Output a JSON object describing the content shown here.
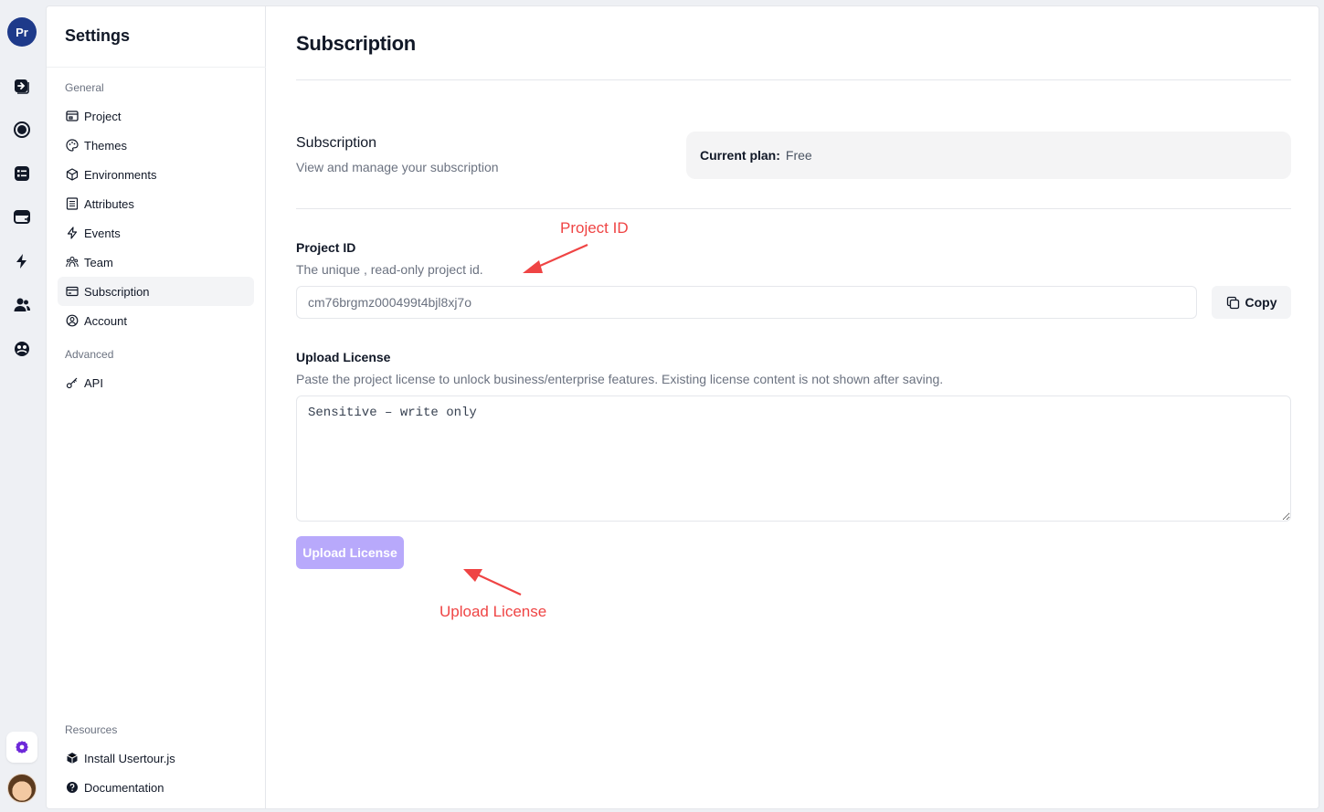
{
  "rail": {
    "project_badge": "Pr",
    "icons": [
      "flows-icon",
      "checklists-icon",
      "launchers-icon",
      "banners-icon",
      "events-icon",
      "users-icon",
      "companies-icon"
    ]
  },
  "sidebar": {
    "title": "Settings",
    "groups": [
      {
        "label": "General",
        "items": [
          {
            "label": "Project",
            "icon": "project-icon"
          },
          {
            "label": "Themes",
            "icon": "palette-icon"
          },
          {
            "label": "Environments",
            "icon": "cube-icon"
          },
          {
            "label": "Attributes",
            "icon": "list-icon"
          },
          {
            "label": "Events",
            "icon": "bolt-icon"
          },
          {
            "label": "Team",
            "icon": "team-icon"
          },
          {
            "label": "Subscription",
            "icon": "card-icon",
            "active": true
          },
          {
            "label": "Account",
            "icon": "account-icon"
          }
        ]
      },
      {
        "label": "Advanced",
        "items": [
          {
            "label": "API",
            "icon": "key-icon"
          }
        ]
      },
      {
        "label": "Resources",
        "items": [
          {
            "label": "Install Usertour.js",
            "icon": "package-icon"
          },
          {
            "label": "Documentation",
            "icon": "help-icon"
          }
        ]
      }
    ]
  },
  "main": {
    "page_title": "Subscription",
    "subscription": {
      "title": "Subscription",
      "description": "View and manage your subscription",
      "current_plan_label": "Current plan:",
      "current_plan_value": "Free"
    },
    "project_id": {
      "label": "Project ID",
      "description": "The unique , read-only project id.",
      "value": "cm76brgmz000499t4bjl8xj7o",
      "copy_label": "Copy"
    },
    "upload_license": {
      "label": "Upload License",
      "description": "Paste the project license to unlock business/enterprise features. Existing license content is not shown after saving.",
      "placeholder": "Sensitive – write only",
      "button_label": "Upload License"
    }
  },
  "annotations": {
    "project_id": "Project ID",
    "upload_license": "Upload License"
  },
  "colors": {
    "accent_disabled": "#b8a9fb",
    "badge": "#1e3a8a",
    "annotation": "#ef4444",
    "settings_icon": "#6d28d9"
  }
}
